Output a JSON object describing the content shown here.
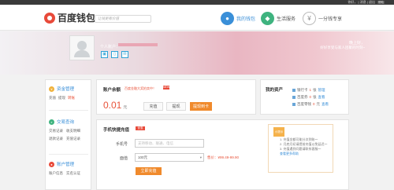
{
  "topbar": {
    "user": "你好，",
    "user_name": "",
    "separator": "|",
    "msg": "消息",
    "exit": "退出",
    "help": "帮助"
  },
  "header": {
    "logo": "百度钱包",
    "slogan": "让钱更有价值"
  },
  "nav": [
    {
      "label": "我的钱包",
      "icon": "user-icon"
    },
    {
      "label": "生活服务",
      "icon": "service-icon"
    },
    {
      "label": "一分钱专享",
      "icon": "coin-icon"
    }
  ],
  "banner": {
    "account_label": "个人账户：",
    "greeting": "晚上好，",
    "greeting_sub": "好好享受与家人团聚的时刻~"
  },
  "sidebar": {
    "sections": [
      {
        "title": "资金管理",
        "links": [
          "充值",
          "提现",
          "转账"
        ],
        "active": "转账"
      },
      {
        "title": "交易查询",
        "rows": [
          [
            "交易记录",
            "收支明细"
          ],
          [
            "退款记录",
            "充值记录"
          ]
        ]
      },
      {
        "title": "账户管理",
        "rows": [
          [
            "账户信息",
            "实名认证"
          ]
        ]
      }
    ]
  },
  "balance": {
    "title": "账户余额",
    "note": "百度金融大奖拍卖中！",
    "tag": "NEW",
    "amount": "0.01",
    "unit": "元",
    "buttons": {
      "recharge": "充值",
      "withdraw": "提现",
      "card": "提现到卡"
    }
  },
  "assets": {
    "title": "我的资产",
    "items": [
      {
        "label": "银行卡",
        "count": "1",
        "unit": "张",
        "link": "管理"
      },
      {
        "label": "百度券",
        "count": "0",
        "unit": "张",
        "link": "查看"
      },
      {
        "label": "百度零钱",
        "count": "0",
        "unit": "元",
        "link": "查看"
      }
    ]
  },
  "recharge": {
    "title": "手机快捷充值",
    "tag": "优惠",
    "phone_label": "手机号",
    "phone_placeholder": "支持移动、联通、电信",
    "amount_label": "面值",
    "amount_value": "100元",
    "price": "售价：¥99.49-99.90",
    "submit": "立即充值"
  },
  "tip": {
    "badge": "小提示",
    "lines": [
      "1. 充值金额可能分次到账～",
      "2. 月底月初请提前充值以免延迟～",
      "3. 充值遇到问题请联系客服～"
    ],
    "link": "查看更多帮助"
  }
}
